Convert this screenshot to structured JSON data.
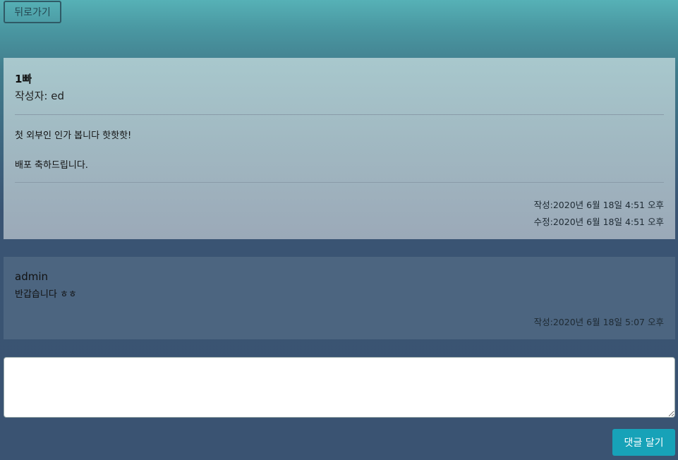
{
  "nav": {
    "back_label": "뒤로가기"
  },
  "post": {
    "title": "1빠",
    "author_line": "작성자: ed",
    "body_lines": [
      "첫 외부인 인가 봅니다 핫핫핫!",
      "배포 축하드립니다."
    ],
    "created": "작성:2020년 6월 18일 4:51 오후",
    "modified": "수정:2020년 6월 18일 4:51 오후"
  },
  "comments": [
    {
      "user": "admin",
      "text": "반갑습니다 ㅎㅎ",
      "created": "작성:2020년 6월 18일 5:07 오후"
    }
  ],
  "reply": {
    "value": "",
    "button_label": "댓글 달기"
  },
  "colors": {
    "accent_button": "#17a2b8",
    "background_top": "#56b1b6",
    "background_bottom": "#3a5372"
  }
}
